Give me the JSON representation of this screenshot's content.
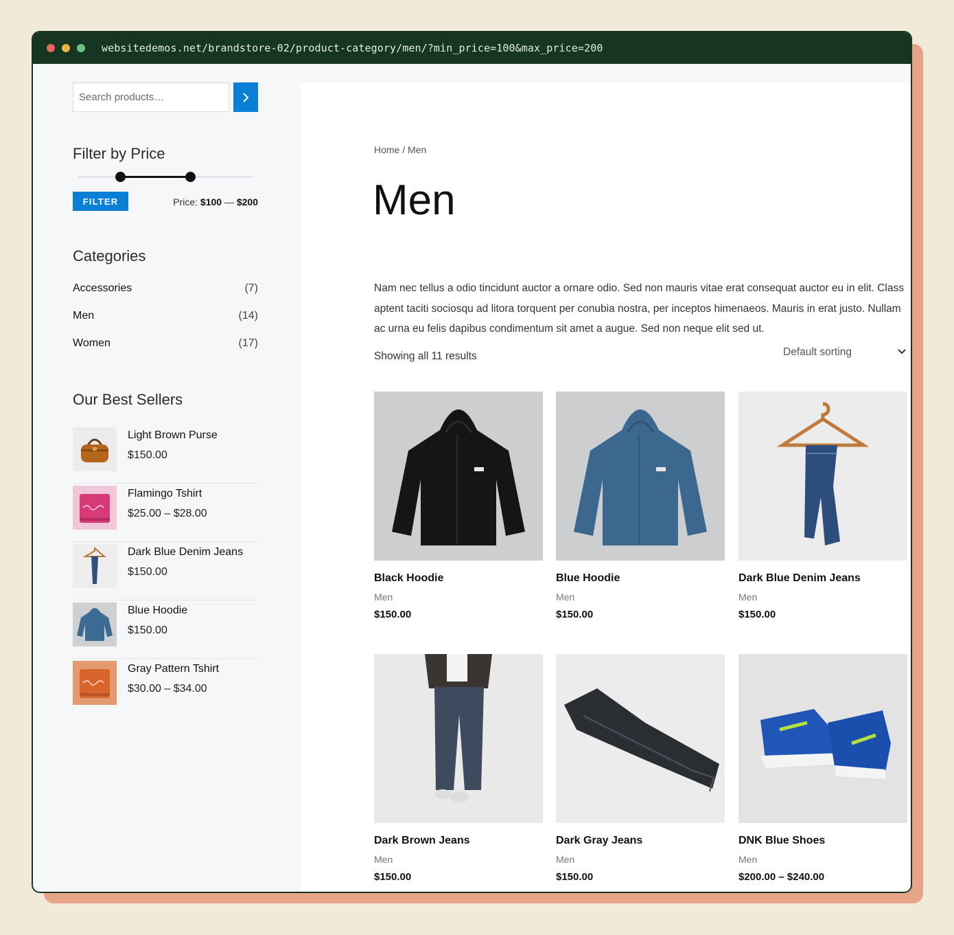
{
  "browser": {
    "url": "websitedemos.net/brandstore-02/product-category/men/?min_price=100&max_price=200"
  },
  "search": {
    "placeholder": "Search products…"
  },
  "price_filter": {
    "title": "Filter by Price",
    "button_label": "FILTER",
    "price_prefix": "Price:",
    "min": "$100",
    "separator": "—",
    "max": "$200",
    "range_min_fraction": 0.24,
    "range_max_fraction": 0.64
  },
  "categories": {
    "title": "Categories",
    "items": [
      {
        "name": "Accessories",
        "count": "(7)"
      },
      {
        "name": "Men",
        "count": "(14)"
      },
      {
        "name": "Women",
        "count": "(17)"
      }
    ]
  },
  "best_sellers": {
    "title": "Our Best Sellers",
    "items": [
      {
        "name": "Light Brown Purse",
        "price": "$150.00",
        "icon": "purse-image"
      },
      {
        "name": "Flamingo Tshirt",
        "price": "$25.00 – $28.00",
        "icon": "pink-tshirt-image"
      },
      {
        "name": "Dark Blue Denim Jeans",
        "price": "$150.00",
        "icon": "jeans-hanger-image"
      },
      {
        "name": "Blue Hoodie",
        "price": "$150.00",
        "icon": "blue-hoodie-image"
      },
      {
        "name": "Gray Pattern Tshirt",
        "price": "$30.00 – $34.00",
        "icon": "orange-tshirt-image"
      }
    ]
  },
  "main": {
    "breadcrumb": "Home / Men",
    "title": "Men",
    "description": "Nam nec tellus a odio tincidunt auctor a ornare odio. Sed non mauris vitae erat consequat auctor eu in elit. Class aptent taciti sociosqu ad litora torquent per conubia nostra, per inceptos himenaeos. Mauris in erat justo. Nullam ac urna eu felis dapibus condimentum sit amet a augue. Sed non neque elit sed ut.",
    "result_count": "Showing all 11 results",
    "sorting": "Default sorting"
  },
  "products": [
    {
      "name": "Black Hoodie",
      "category": "Men",
      "price": "$150.00",
      "icon": "black-hoodie-image"
    },
    {
      "name": "Blue Hoodie",
      "category": "Men",
      "price": "$150.00",
      "icon": "blue-hoodie-image"
    },
    {
      "name": "Dark Blue Denim Jeans",
      "category": "Men",
      "price": "$150.00",
      "icon": "jeans-hanger-image"
    },
    {
      "name": "Dark Brown Jeans",
      "category": "Men",
      "price": "$150.00",
      "icon": "model-jeans-image"
    },
    {
      "name": "Dark Gray Jeans",
      "category": "Men",
      "price": "$150.00",
      "icon": "gray-jeans-image"
    },
    {
      "name": "DNK Blue Shoes",
      "category": "Men",
      "price": "$200.00 – $240.00",
      "icon": "blue-shoes-image"
    }
  ],
  "colors": {
    "accent": "#0a7fd6",
    "window_frame": "#163622",
    "page_bg": "#f1ead8",
    "shadow": "#e6a588"
  }
}
